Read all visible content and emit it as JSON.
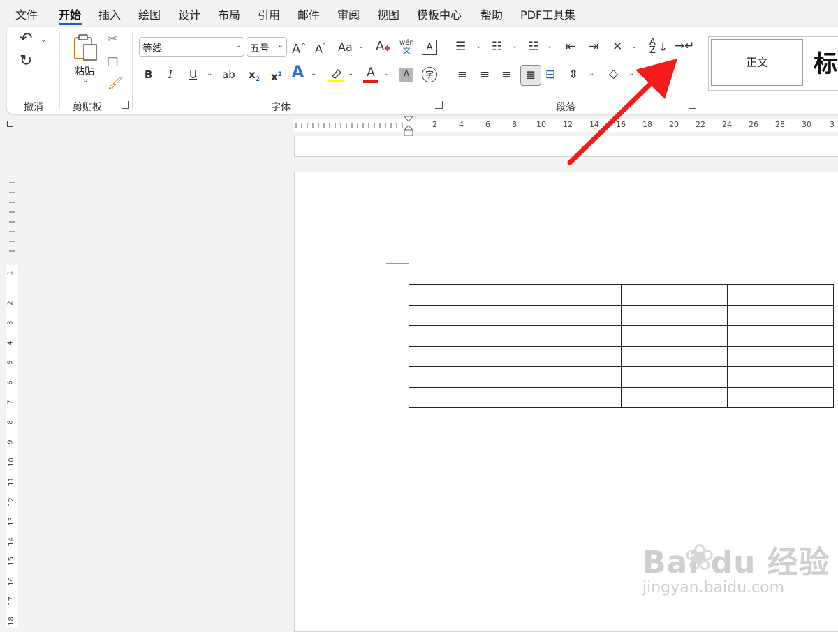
{
  "menu": {
    "items": [
      "文件",
      "开始",
      "插入",
      "绘图",
      "设计",
      "布局",
      "引用",
      "邮件",
      "审阅",
      "视图",
      "模板中心",
      "帮助",
      "PDF工具集"
    ],
    "active": "开始"
  },
  "ribbon": {
    "groups": {
      "undo": "撤消",
      "clipboard": "剪贴板",
      "font": "字体",
      "paragraph": "段落"
    },
    "clipboard": {
      "paste_label": "粘贴"
    },
    "font": {
      "font_name": "等线",
      "font_size": "五号",
      "bold": "B",
      "italic": "I",
      "underline": "U",
      "strike": "ab",
      "subscript": "x",
      "superscript": "x",
      "change_case": "Aa",
      "phonetic_top": "wén",
      "phonetic_bottom": "文",
      "border_char": "A",
      "circle_char": "字",
      "text_effect": "A",
      "font_color": "A",
      "shading": "A"
    },
    "styles": {
      "normal": "正文",
      "title": "标"
    }
  },
  "ruler": {
    "horizontal_labels": [
      "2",
      "4",
      "6",
      "8",
      "10",
      "12",
      "14",
      "16",
      "18",
      "20",
      "22",
      "24",
      "26",
      "28",
      "30",
      "3"
    ],
    "vertical_labels": [
      "1",
      "2",
      "3",
      "4",
      "5",
      "6",
      "7",
      "8",
      "9",
      "10",
      "11",
      "12",
      "13",
      "14",
      "15",
      "16",
      "17",
      "18"
    ]
  },
  "document": {
    "table": {
      "rows": 6,
      "cols": 4
    }
  },
  "watermark": {
    "main": "Bai du 经验",
    "sub": "jingyan.baidu.com"
  },
  "colors": {
    "accent": "#1a5fb4",
    "arrow": "#f21c1c",
    "highlight": "#ffff00",
    "font_color": "#e01b1b"
  }
}
